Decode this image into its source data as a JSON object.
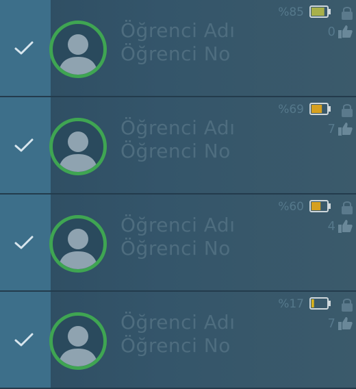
{
  "students": [
    {
      "name": "Öğrenci Adı",
      "number": "Öğrenci No",
      "battery": "%85",
      "battery_level": 0.85,
      "likes": "0",
      "selected": true
    },
    {
      "name": "Öğrenci Adı",
      "number": "Öğrenci No",
      "battery": "%69",
      "battery_level": 0.69,
      "likes": "7",
      "selected": true
    },
    {
      "name": "Öğrenci Adı",
      "number": "Öğrenci No",
      "battery": "%60",
      "battery_level": 0.6,
      "likes": "4",
      "selected": true
    },
    {
      "name": "Öğrenci Adı",
      "number": "Öğrenci No",
      "battery": "%17",
      "battery_level": 0.17,
      "likes": "7",
      "selected": true
    }
  ],
  "icons": {
    "check": "check-icon",
    "avatar": "user-avatar-icon",
    "battery": "battery-icon",
    "lock": "lock-icon",
    "thumb": "thumbs-up-icon"
  },
  "colors": {
    "avatar_ring": "#3fa552",
    "battery_high": "#a8b04a",
    "battery_mid": "#d6a020",
    "battery_low": "#d9b21c",
    "text_dim": "#4e6d7f"
  }
}
